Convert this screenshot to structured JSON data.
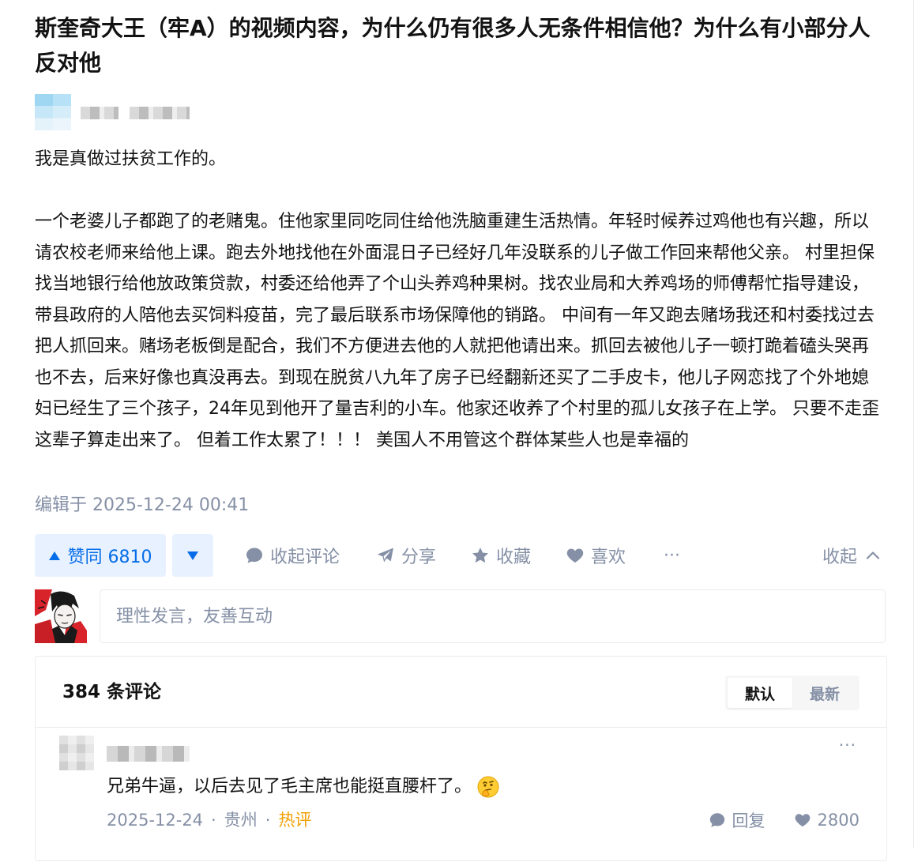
{
  "question": {
    "title": "斯奎奇大王（牢A）的视频内容，为什么仍有很多人无条件相信他？为什么有小部分人反对他"
  },
  "answer": {
    "paragraphs": [
      "我是真做过扶贫工作的。",
      "一个老婆儿子都跑了的老赌鬼。住他家里同吃同住给他洗脑重建生活热情。年轻时候养过鸡他也有兴趣，所以请农校老师来给他上课。跑去外地找他在外面混日子已经好几年没联系的儿子做工作回来帮他父亲。 村里担保找当地银行给他放政策贷款，村委还给他弄了个山头养鸡种果树。找农业局和大养鸡场的师傅帮忙指导建设，带县政府的人陪他去买饲料疫苗，完了最后联系市场保障他的销路。 中间有一年又跑去赌场我还和村委找过去把人抓回来。赌场老板倒是配合，我们不方便进去他的人就把他请出来。抓回去被他儿子一顿打跪着磕头哭再也不去，后来好像也真没再去。到现在脱贫八九年了房子已经翻新还买了二手皮卡，他儿子网恋找了个外地媳妇已经生了三个孩子，24年见到他开了量吉利的小车。他家还收养了个村里的孤儿女孩子在上学。 只要不走歪这辈子算走出来了。 但着工作太累了！！！ 美国人不用管这个群体某些人也是幸福的"
    ],
    "edited_label": "编辑于 2025-12-24 00:41"
  },
  "actions": {
    "vote_up_label": "赞同 6810",
    "collapse_comments_label": "收起评论",
    "share_label": "分享",
    "favorite_label": "收藏",
    "like_label": "喜欢",
    "more_label": "···",
    "collapse_label": "收起"
  },
  "comment_editor": {
    "placeholder": "理性发言，友善互动"
  },
  "comments": {
    "count_label": "384 条评论",
    "sort": {
      "default_label": "默认",
      "latest_label": "最新",
      "active": "default"
    },
    "items": [
      {
        "text": "兄弟牛逼，以后去见了毛主席也能挺直腰杆了。",
        "emoji": "thinking-face-icon",
        "date": "2025-12-24",
        "location": "贵州",
        "tag": "热评",
        "reply_label": "回复",
        "likes": "2800"
      }
    ]
  },
  "colors": {
    "accent": "#056de8",
    "accent_bg": "#e8f1ff",
    "muted": "#8590a6",
    "hot": "#f1a104",
    "text": "#121212",
    "border": "#ebebeb"
  }
}
